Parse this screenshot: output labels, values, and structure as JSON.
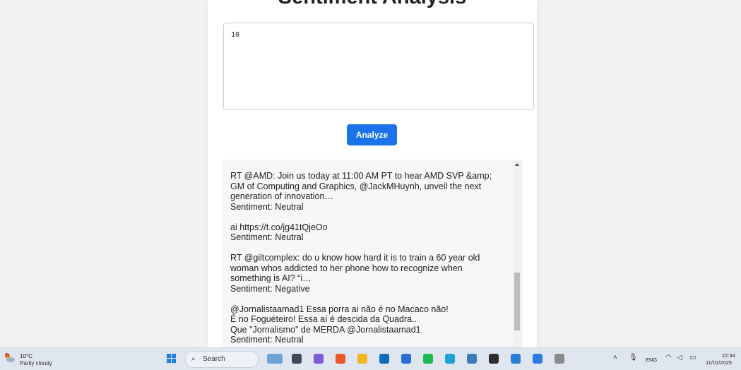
{
  "page": {
    "title": "Sentiment Analysis",
    "input_value": "10",
    "analyze_label": "Analyze"
  },
  "results": [
    {
      "text": "RT @AMD: Join us today at 11:00 AM PT to hear AMD SVP &amp;\nGM of Computing and Graphics, @JackMHuynh, unveil the next\ngeneration of innovation…",
      "sentiment": "Sentiment: Neutral"
    },
    {
      "text": "ai https://t.co/jg41tQjeOo",
      "sentiment": "Sentiment: Neutral"
    },
    {
      "text": "RT @giltcomplex: do u know how hard it is to train a 60 year old\nwoman whos addicted to her phone how to recognize when\nsomething is AI? “i…",
      "sentiment": "Sentiment: Negative"
    },
    {
      "text": "@Jornalistaamad1 Essa porra ai não é no Macaco não!\nÉ no Foguéteiro! Essa aí é descida da Quadra..\nQue \"Jornalismo\" de MERDA @Jornalistaamad1",
      "sentiment": "Sentiment: Neutral"
    }
  ],
  "taskbar": {
    "weather_temp": "10°C",
    "weather_desc": "Partly cloudy",
    "weather_badge": "1",
    "search_label": "Search",
    "language": "ENG",
    "time": "22:34",
    "date": "11/01/2025",
    "pinned_apps": [
      {
        "name": "widgets-app",
        "color": "#6ba3d6"
      },
      {
        "name": "task-view",
        "color": "#3c4a5c"
      },
      {
        "name": "copilot-app",
        "color": "#7b5cd6"
      },
      {
        "name": "brave-browser",
        "color": "#e8582a"
      },
      {
        "name": "file-explorer",
        "color": "#f2b61f"
      },
      {
        "name": "outlook-app",
        "color": "#0f6cbd"
      },
      {
        "name": "ms-store",
        "color": "#2b6fd6"
      },
      {
        "name": "spotify-app",
        "color": "#1db954"
      },
      {
        "name": "edge-browser",
        "color": "#1fa3d6"
      },
      {
        "name": "python-app",
        "color": "#3d7ab8"
      },
      {
        "name": "terminal-app",
        "color": "#2e2e2e"
      },
      {
        "name": "vscode-app",
        "color": "#2a7fd4"
      },
      {
        "name": "notepad-app",
        "color": "#2c7be5"
      },
      {
        "name": "snipping-tool",
        "color": "#8a8a8a"
      }
    ]
  }
}
